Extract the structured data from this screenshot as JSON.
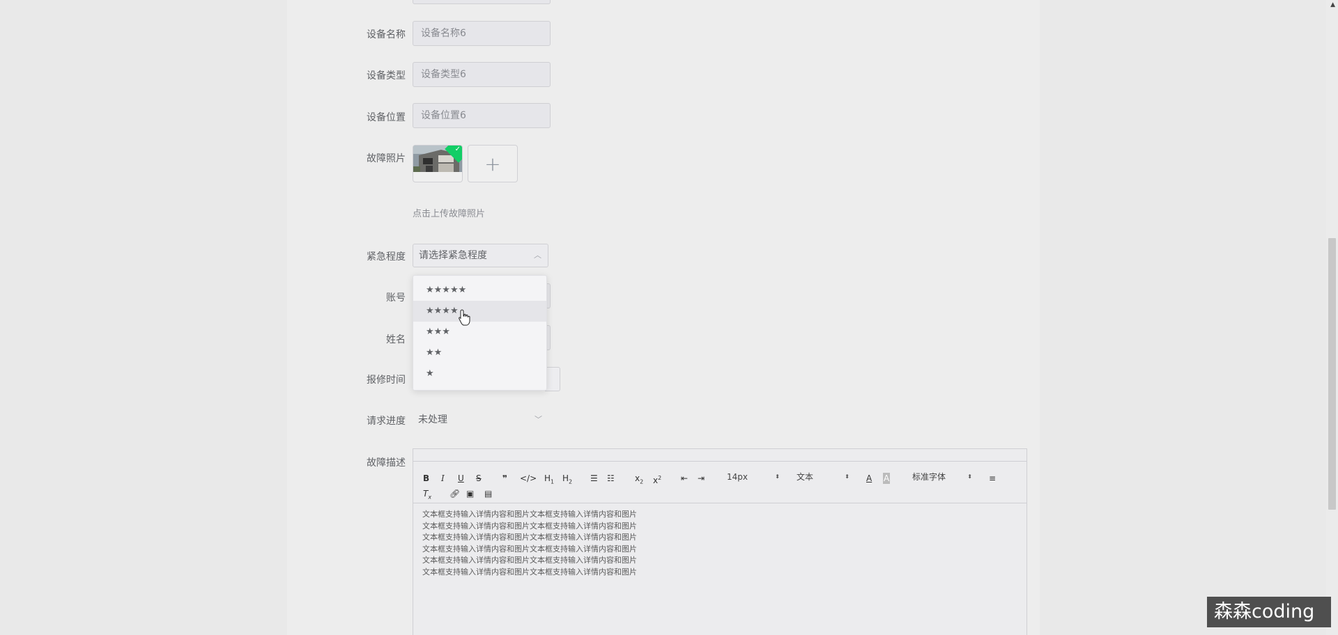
{
  "form": {
    "device_name": {
      "label": "设备名称",
      "value": "设备名称6"
    },
    "device_type": {
      "label": "设备类型",
      "value": "设备类型6"
    },
    "device_location": {
      "label": "设备位置",
      "value": "设备位置6"
    },
    "fault_photo": {
      "label": "故障照片",
      "hint": "点击上传故障照片",
      "add_symbol": "+"
    },
    "urgency": {
      "label": "紧急程度",
      "placeholder": "请选择紧急程度",
      "options": [
        "★★★★★",
        "★★★★",
        "★★★",
        "★★",
        "★"
      ],
      "hovered_index": 1
    },
    "account": {
      "label": "账号"
    },
    "name": {
      "label": "姓名"
    },
    "repair_time": {
      "label": "报修时间"
    },
    "progress": {
      "label": "请求进度",
      "value": "未处理"
    },
    "description": {
      "label": "故障描述",
      "toolbar": {
        "font_size": "14px",
        "header": "文本",
        "font_family": "标准字体"
      },
      "lines": [
        "文本框支持输入详情内容和图片文本框支持输入详情内容和图片",
        "文本框支持输入详情内容和图片文本框支持输入详情内容和图片",
        "文本框支持输入详情内容和图片文本框支持输入详情内容和图片",
        "文本框支持输入详情内容和图片文本框支持输入详情内容和图片",
        "文本框支持输入详情内容和图片文本框支持输入详情内容和图片",
        "文本框支持输入详情内容和图片文本框支持输入详情内容和图片"
      ]
    }
  },
  "watermark": "森森coding",
  "colors": {
    "success_badge": "#13ce66",
    "background": "#e9e9e9"
  }
}
